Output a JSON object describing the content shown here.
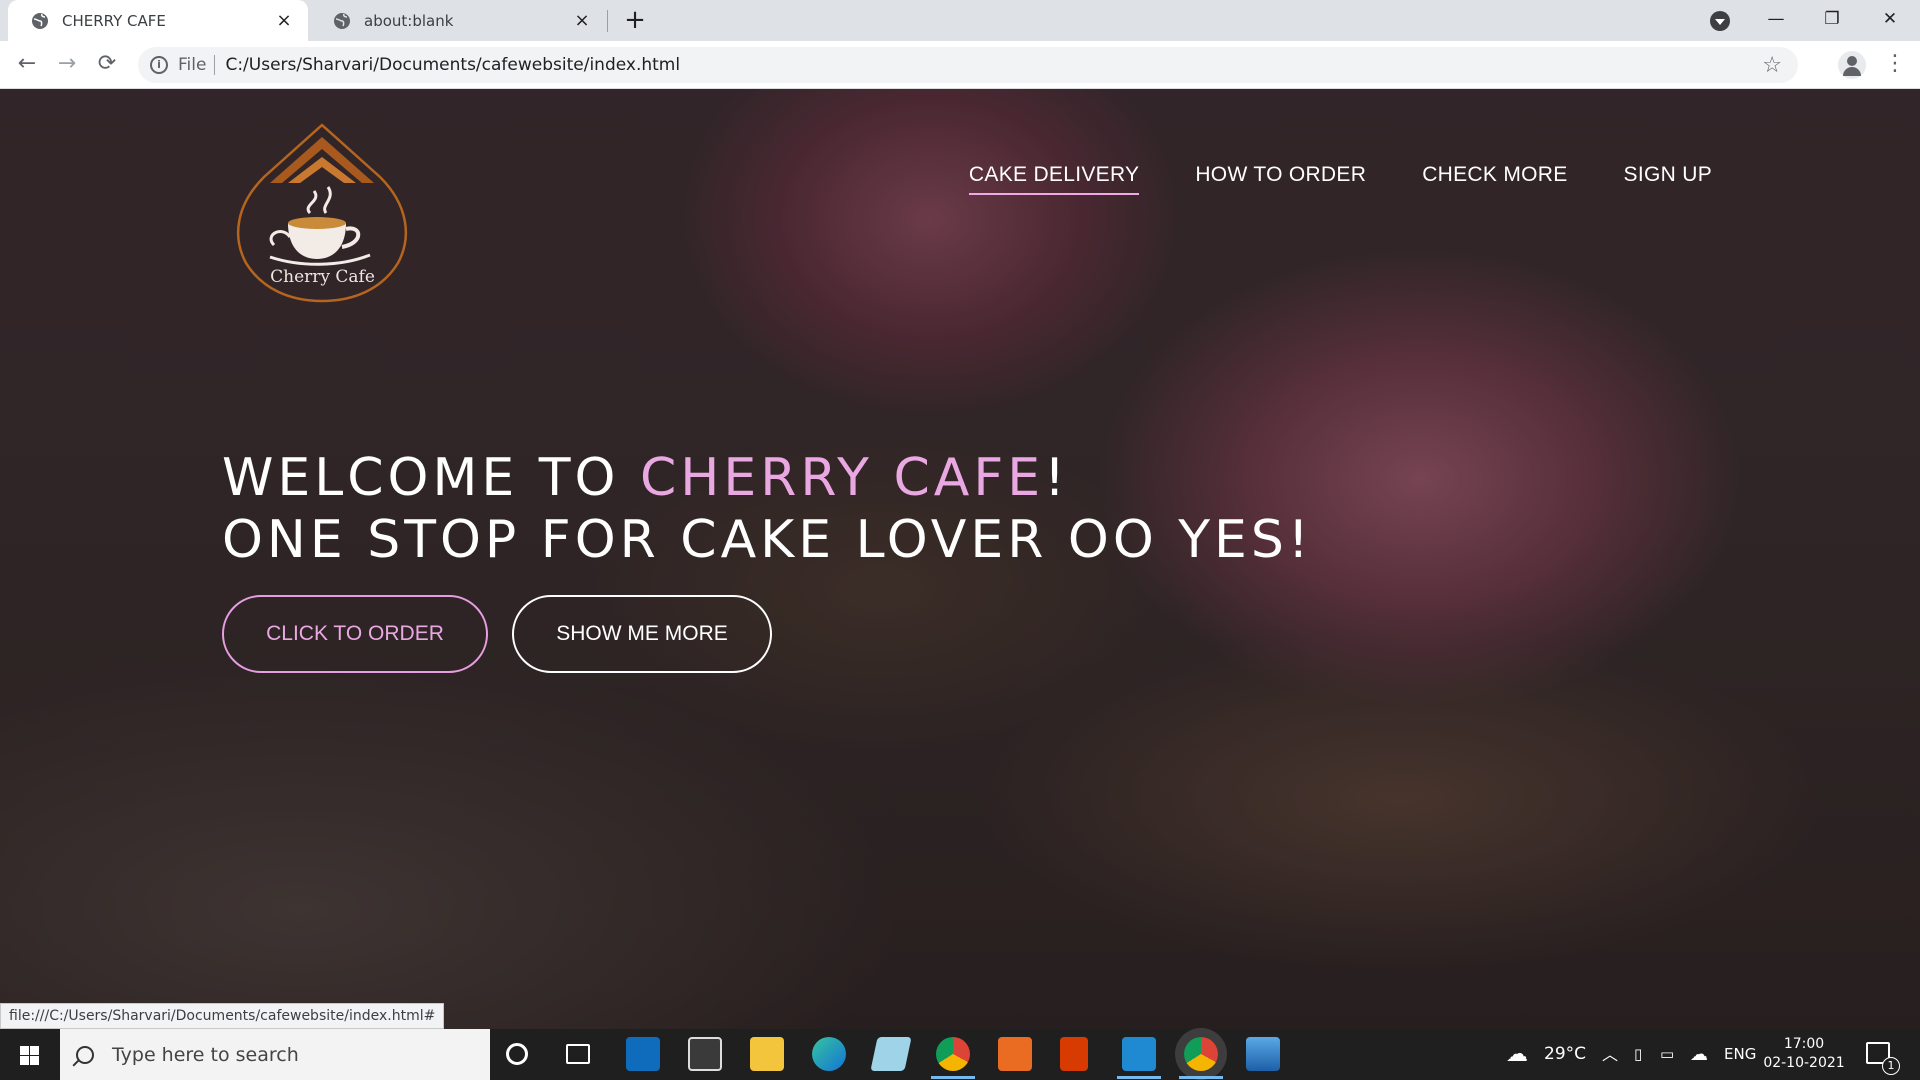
{
  "browser": {
    "tabs": [
      {
        "title": "CHERRY CAFE",
        "close": "×"
      },
      {
        "title": "about:blank",
        "close": "×"
      }
    ],
    "new_tab": "+",
    "window_controls": {
      "minimize": "—",
      "restore": "❐",
      "close": "✕"
    },
    "back": "←",
    "forward": "→",
    "reload": "⟳",
    "omnibox": {
      "scheme_label": "File",
      "url": "C:/Users/Sharvari/Documents/cafewebsite/index.html",
      "bookmark": "☆"
    },
    "menu": "⋮",
    "status_url": "file:///C:/Users/Sharvari/Documents/cafewebsite/index.html#"
  },
  "site": {
    "logo_text": "Cherry Cafe",
    "nav": [
      {
        "label": "CAKE DELIVERY",
        "active": true
      },
      {
        "label": "HOW TO ORDER",
        "active": false
      },
      {
        "label": "CHECK MORE",
        "active": false
      },
      {
        "label": "SIGN UP",
        "active": false
      }
    ],
    "hero": {
      "line1_prefix": "WELCOME TO ",
      "line1_highlight": "CHERRY CAFE",
      "line1_suffix": "!",
      "line2": "ONE STOP FOR CAKE LOVER OO YES!"
    },
    "buttons": {
      "order": "CLICK TO ORDER",
      "more": "SHOW ME MORE"
    },
    "colors": {
      "accent_pink": "#eaa8e2",
      "nav_text": "#ffffff"
    }
  },
  "taskbar": {
    "search_placeholder": "Type here to search",
    "weather": "29°C",
    "language": "ENG",
    "time": "17:00",
    "date": "02-10-2021",
    "notifications": "1",
    "apps": [
      "cortana-icon",
      "task-view-icon",
      "mail-icon",
      "store-icon",
      "file-explorer-icon",
      "edge-icon",
      "notes-icon",
      "chrome-alt-icon",
      "office-files-icon",
      "office-icon",
      "vscode-icon",
      "chrome-icon",
      "photos-icon"
    ]
  }
}
